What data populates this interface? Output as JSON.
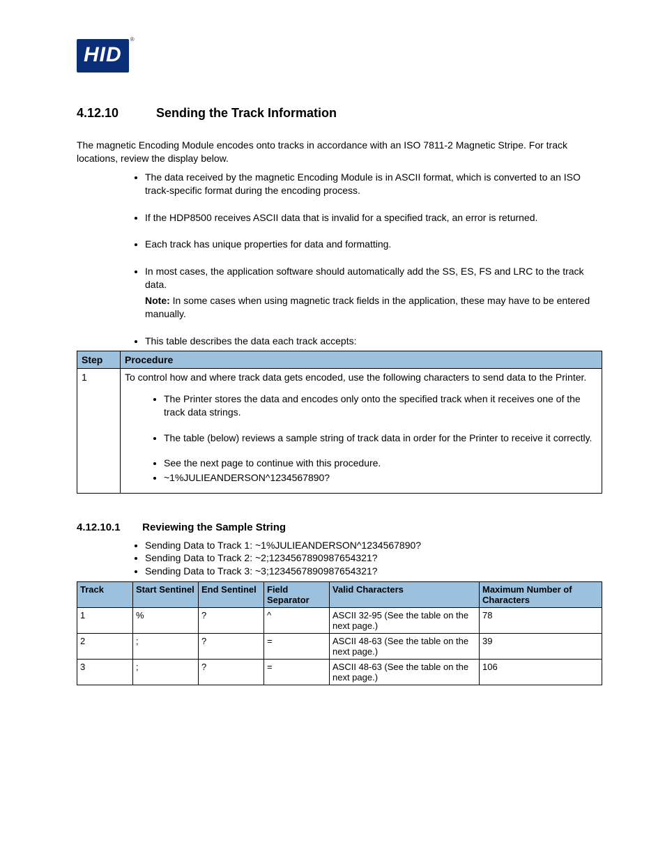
{
  "logo": {
    "text": "HID",
    "reg": "®"
  },
  "section": {
    "number": "4.12.10",
    "title": "Sending the Track Information",
    "intro": "The magnetic Encoding Module encodes onto tracks in accordance with an ISO 7811-2 Magnetic Stripe. For track locations, review the display below.",
    "bullets": [
      {
        "text": "The data received by the magnetic Encoding Module is in ASCII format, which is converted to an ISO track-specific format during the encoding process."
      },
      {
        "text": "If the HDP8500 receives ASCII data that is invalid for a specified track, an error is returned."
      },
      {
        "text": "Each track has unique properties for data and formatting."
      },
      {
        "text": "In most cases, the application software should automatically add the SS, ES, FS and LRC to the track data.",
        "note_label": "Note:",
        "note_body": "In some cases when using magnetic track fields in the application, these may have to be entered manually."
      },
      {
        "text": "This table describes the data each track accepts:"
      }
    ]
  },
  "procedure_table": {
    "headers": {
      "step": "Step",
      "procedure": "Procedure"
    },
    "row": {
      "step": "1",
      "lead": "To control how and where track data gets encoded, use the following characters to send data to the Printer.",
      "bullets": [
        "The Printer stores the data and encodes only onto the specified track when it receives one of the track data strings.",
        "The table (below) reviews a sample string of track data in order for the Printer to receive it correctly.",
        "See the next page to continue with this procedure.",
        "~1%JULIEANDERSON^1234567890?"
      ]
    }
  },
  "subsection": {
    "number": "4.12.10.1",
    "title": "Reviewing the Sample String",
    "bullets": [
      "Sending Data to Track 1: ~1%JULIEANDERSON^1234567890?",
      "Sending Data to Track 2: ~2;1234567890987654321?",
      "Sending Data to Track 3: ~3;1234567890987654321?"
    ]
  },
  "char_table": {
    "headers": {
      "track": "Track",
      "ss": "Start Sentinel",
      "es": "End Sentinel",
      "fs": "Field Separator",
      "vc": "Valid Characters",
      "max": "Maximum Number of Characters"
    },
    "rows": [
      {
        "track": "1",
        "ss": "%",
        "es": "?",
        "fs": "^",
        "vc": "ASCII 32-95 (See the table on the next page.)",
        "max": "78"
      },
      {
        "track": "2",
        "ss": ";",
        "es": "?",
        "fs": "=",
        "vc": "ASCII 48-63 (See the table on the next page.)",
        "max": "39"
      },
      {
        "track": "3",
        "ss": ";",
        "es": "?",
        "fs": "=",
        "vc": "ASCII 48-63 (See the table on the next page.)",
        "max": "106"
      }
    ]
  }
}
